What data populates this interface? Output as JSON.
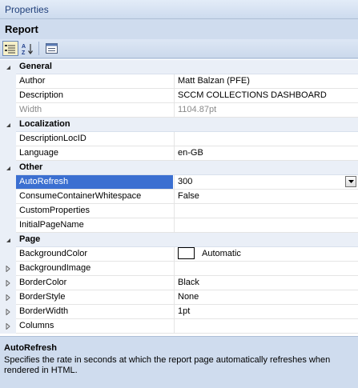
{
  "panel": {
    "title": "Properties",
    "object_name": "Report"
  },
  "toolbar": {
    "categorized_icon": "categorized-view-icon",
    "alphabetical_icon": "alphabetical-sort-icon",
    "pages_icon": "property-pages-icon"
  },
  "grid": {
    "categories": {
      "general": "General",
      "localization": "Localization",
      "other": "Other",
      "page": "Page"
    },
    "general": [
      {
        "name": "Author",
        "value": "Matt Balzan (PFE)"
      },
      {
        "name": "Description",
        "value": "SCCM COLLECTIONS DASHBOARD"
      },
      {
        "name": "Width",
        "value": "1104.87pt"
      }
    ],
    "localization": [
      {
        "name": "DescriptionLocID",
        "value": ""
      },
      {
        "name": "Language",
        "value": "en-GB"
      }
    ],
    "other": [
      {
        "name": "AutoRefresh",
        "value": "300"
      },
      {
        "name": "ConsumeContainerWhitespace",
        "value": "False"
      },
      {
        "name": "CustomProperties",
        "value": ""
      },
      {
        "name": "InitialPageName",
        "value": ""
      }
    ],
    "page": [
      {
        "name": "BackgroundColor",
        "value": "Automatic"
      },
      {
        "name": "BackgroundImage",
        "value": ""
      },
      {
        "name": "BorderColor",
        "value": "Black"
      },
      {
        "name": "BorderStyle",
        "value": "None"
      },
      {
        "name": "BorderWidth",
        "value": "1pt"
      },
      {
        "name": "Columns",
        "value": ""
      }
    ]
  },
  "description": {
    "title": "AutoRefresh",
    "text": "Specifies the rate in seconds at which the report page automatically refreshes when rendered in HTML."
  },
  "colors": {
    "selection": "#3b6fd1",
    "background_swatch": "#ffffff"
  }
}
